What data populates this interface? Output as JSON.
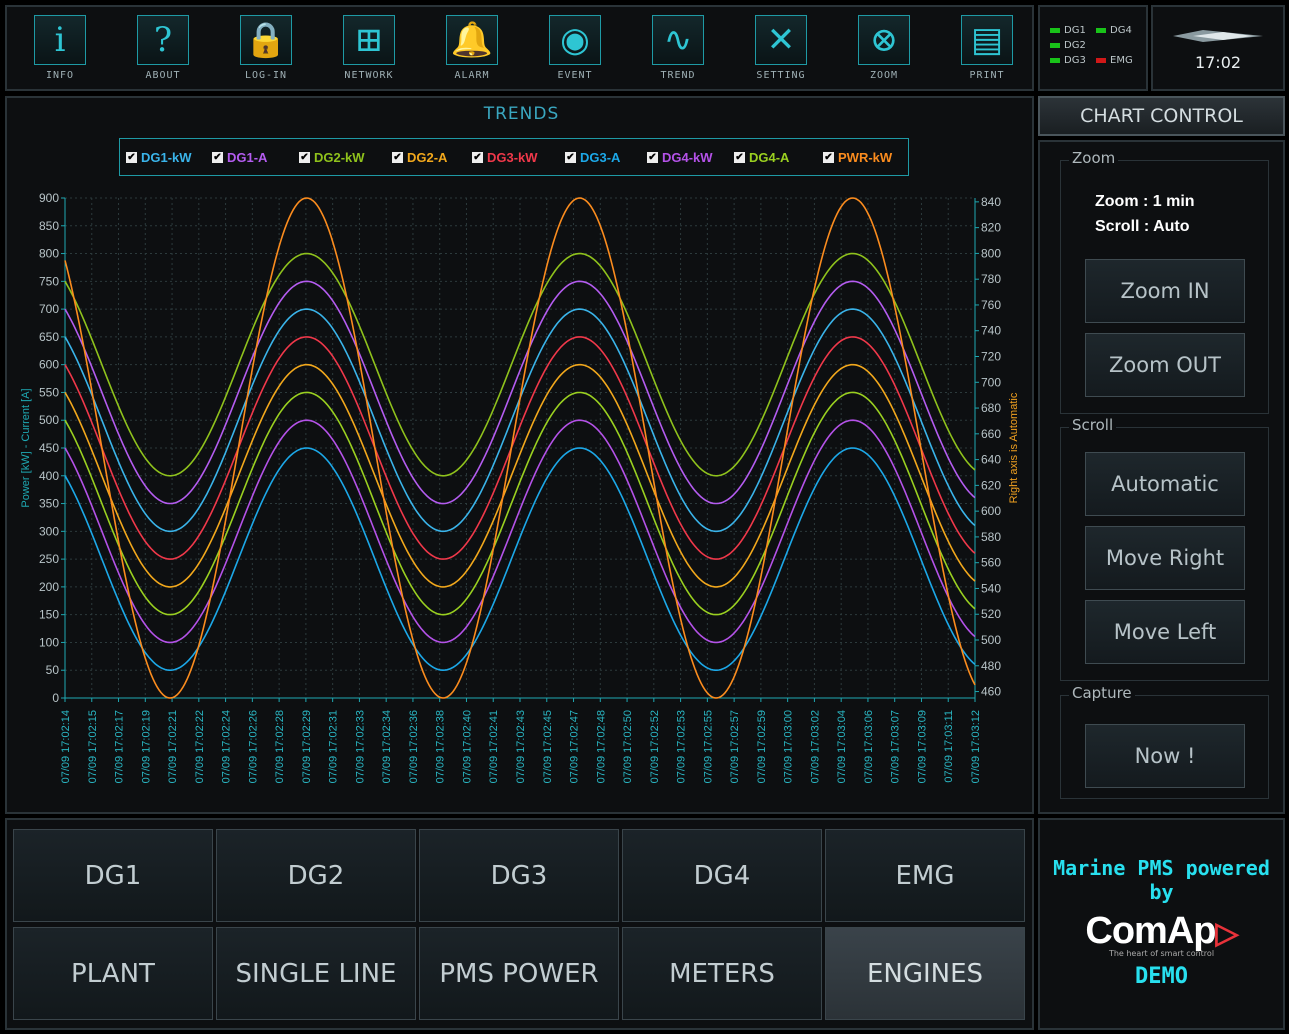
{
  "toolbar": [
    {
      "label": "INFO",
      "icon": "info-icon",
      "glyph": "i"
    },
    {
      "label": "ABOUT",
      "icon": "question-icon",
      "glyph": "?"
    },
    {
      "label": "LOG-IN",
      "icon": "lock-icon",
      "glyph": "🔒"
    },
    {
      "label": "NETWORK",
      "icon": "network-icon",
      "glyph": "⊞"
    },
    {
      "label": "ALARM",
      "icon": "bell-icon",
      "glyph": "🔔"
    },
    {
      "label": "EVENT",
      "icon": "whistle-icon",
      "glyph": "◉"
    },
    {
      "label": "TREND",
      "icon": "trend-icon",
      "glyph": "∿"
    },
    {
      "label": "SETTING",
      "icon": "tools-icon",
      "glyph": "✕"
    },
    {
      "label": "ZOOM",
      "icon": "zoom-icon",
      "glyph": "⊗"
    },
    {
      "label": "PRINT",
      "icon": "printer-icon",
      "glyph": "▤"
    }
  ],
  "status": {
    "items": [
      {
        "label": "DG1",
        "color": "#19c319"
      },
      {
        "label": "DG4",
        "color": "#19c319"
      },
      {
        "label": "DG2",
        "color": "#19c319"
      },
      {
        "label": "DG3",
        "color": "#19c319"
      },
      {
        "label": "EMG",
        "color": "#d01818"
      }
    ],
    "time": "17:02"
  },
  "trends_title": "TRENDS",
  "chart_data": {
    "type": "line",
    "title": "TRENDS",
    "ylabel": "Power [kW] - Current [A]",
    "y2label": "Right axis  is Automatic",
    "ylim": [
      0,
      900
    ],
    "y2lim": [
      455,
      843
    ],
    "yticks": [
      0,
      50,
      100,
      150,
      200,
      250,
      300,
      350,
      400,
      450,
      500,
      550,
      600,
      650,
      700,
      750,
      800,
      850,
      900
    ],
    "y2ticks": [
      460,
      480,
      500,
      520,
      540,
      560,
      580,
      600,
      620,
      640,
      660,
      680,
      700,
      720,
      740,
      760,
      780,
      800,
      820,
      840
    ],
    "x": [
      "07/09 17:02:14",
      "07/09 17:02:15",
      "07/09 17:02:17",
      "07/09 17:02:19",
      "07/09 17:02:21",
      "07/09 17:02:22",
      "07/09 17:02:24",
      "07/09 17:02:26",
      "07/09 17:02:28",
      "07/09 17:02:29",
      "07/09 17:02:31",
      "07/09 17:02:33",
      "07/09 17:02:34",
      "07/09 17:02:36",
      "07/09 17:02:38",
      "07/09 17:02:40",
      "07/09 17:02:41",
      "07/09 17:02:43",
      "07/09 17:02:45",
      "07/09 17:02:47",
      "07/09 17:02:48",
      "07/09 17:02:50",
      "07/09 17:02:52",
      "07/09 17:02:53",
      "07/09 17:02:55",
      "07/09 17:02:57",
      "07/09 17:02:59",
      "07/09 17:03:00",
      "07/09 17:03:02",
      "07/09 17:03:04",
      "07/09 17:03:06",
      "07/09 17:03:07",
      "07/09 17:03:09",
      "07/09 17:03:11",
      "07/09 17:03:12"
    ],
    "grid": true,
    "period_s": 17.4,
    "peak_x_s": [
      15.4,
      32.8,
      50.2
    ],
    "series": [
      {
        "name": "DG1-kW",
        "color": "#3ab4ea",
        "min": 300,
        "max": 700,
        "axis": "left"
      },
      {
        "name": "DG1-A",
        "color": "#b45cf0",
        "min": 350,
        "max": 750,
        "axis": "left"
      },
      {
        "name": "DG2-kW",
        "color": "#8fc21c",
        "min": 400,
        "max": 800,
        "axis": "left"
      },
      {
        "name": "DG2-A",
        "color": "#f2a81c",
        "min": 200,
        "max": 600,
        "axis": "left"
      },
      {
        "name": "DG3-kW",
        "color": "#f0384a",
        "min": 250,
        "max": 650,
        "axis": "left"
      },
      {
        "name": "DG3-A",
        "color": "#1ca8e8",
        "min": 50,
        "max": 450,
        "axis": "left"
      },
      {
        "name": "DG4-kW",
        "color": "#b452e8",
        "min": 100,
        "max": 500,
        "axis": "left"
      },
      {
        "name": "DG4-A",
        "color": "#9ad020",
        "min": 150,
        "max": 550,
        "axis": "left"
      },
      {
        "name": "PWR-kW",
        "color": "#fb8c1e",
        "min": 455,
        "max": 843,
        "axis": "right"
      }
    ],
    "colors": {
      "axis": "#1ea8b2",
      "grid": "#2c3a3c",
      "y2label": "#f0a020",
      "ylabel": "#1ea8b2"
    }
  },
  "legend": [
    {
      "label": "DG1-kW",
      "color": "#3ab4ea",
      "check": "✔"
    },
    {
      "label": "DG1-A",
      "color": "#b45cf0",
      "check": "✔"
    },
    {
      "label": "DG2-kW",
      "color": "#8fc21c",
      "check": "✔"
    },
    {
      "label": "DG2-A",
      "color": "#f2a81c",
      "check": "✔"
    },
    {
      "label": "DG3-kW",
      "color": "#f0384a",
      "check": "✔"
    },
    {
      "label": "DG3-A",
      "color": "#1ca8e8",
      "check": "✔"
    },
    {
      "label": "DG4-kW",
      "color": "#b452e8",
      "check": "✔"
    },
    {
      "label": "DG4-A",
      "color": "#9ad020",
      "check": "✔"
    },
    {
      "label": "PWR-kW",
      "color": "#fb8c1e",
      "check": "✔"
    }
  ],
  "control": {
    "header": "CHART CONTROL",
    "zoom_title": "Zoom",
    "zoom_info": "Zoom : 1 min",
    "scroll_info": "Scroll : Auto",
    "zoom_in": "Zoom IN",
    "zoom_out": "Zoom OUT",
    "scroll_title": "Scroll",
    "automatic": "Automatic",
    "move_right": "Move Right",
    "move_left": "Move Left",
    "capture_title": "Capture",
    "now": "Now !"
  },
  "nav": [
    {
      "label": "DG1"
    },
    {
      "label": "DG2"
    },
    {
      "label": "DG3"
    },
    {
      "label": "DG4"
    },
    {
      "label": "EMG"
    },
    {
      "label": "PLANT"
    },
    {
      "label": "SINGLE LINE"
    },
    {
      "label": "PMS POWER"
    },
    {
      "label": "METERS"
    },
    {
      "label": "ENGINES",
      "active": true
    }
  ],
  "brand": {
    "line1": "Marine PMS powered",
    "line2": "by",
    "logo": "ComAp",
    "tagline": "The heart of smart control",
    "demo": "DEMO"
  }
}
